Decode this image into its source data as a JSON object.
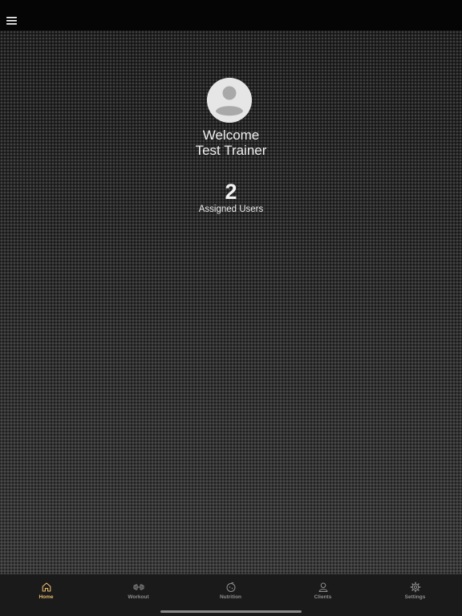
{
  "header": {
    "menu_icon": "hamburger-menu-icon"
  },
  "profile": {
    "avatar_icon": "user-avatar-icon",
    "welcome": "Welcome",
    "name": "Test Trainer"
  },
  "stats": {
    "assigned_users_count": "2",
    "assigned_users_label": "Assigned Users"
  },
  "tabs": [
    {
      "label": "Home",
      "icon": "home-icon",
      "active": true
    },
    {
      "label": "Workout",
      "icon": "dumbbell-icon",
      "active": false
    },
    {
      "label": "Nutrition",
      "icon": "nutrition-icon",
      "active": false
    },
    {
      "label": "Clients",
      "icon": "clients-icon",
      "active": false
    },
    {
      "label": "Settings",
      "icon": "gear-icon",
      "active": false
    }
  ],
  "colors": {
    "accent": "#e7b96a",
    "tab_inactive": "#8e8e8e",
    "tab_bar_background": "#1a1a1a",
    "top_bar_background": "#050505"
  }
}
